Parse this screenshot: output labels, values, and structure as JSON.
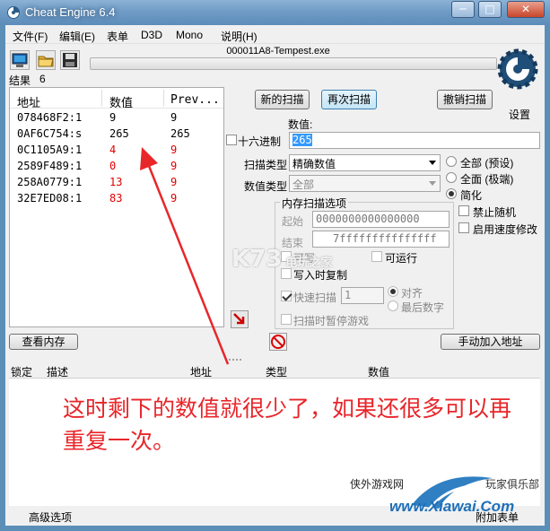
{
  "window": {
    "title": "Cheat Engine 6.4",
    "minimize": "─",
    "maximize": "□",
    "close": "✕"
  },
  "menu": [
    "文件(F)",
    "编辑(E)",
    "表单",
    "D3D",
    "Mono",
    "说明(H)"
  ],
  "toolbar": {
    "open_process_icon": "computer-icon",
    "open_file_icon": "folder-icon",
    "save_icon": "disk-icon"
  },
  "process_name": "000011A8-Tempest.exe",
  "results": {
    "label": "结果",
    "count": "6",
    "columns": [
      "地址",
      "数值",
      "Prev..."
    ],
    "rows": [
      {
        "address": "078468F2:1",
        "value": "9",
        "prev": "9",
        "changed": false
      },
      {
        "address": "0AF6C754:s",
        "value": "265",
        "prev": "265",
        "changed": false
      },
      {
        "address": "0C1105A9:1",
        "value": "4",
        "prev": "9",
        "changed": true
      },
      {
        "address": "2589F489:1",
        "value": "0",
        "prev": "9",
        "changed": true
      },
      {
        "address": "258A0779:1",
        "value": "13",
        "prev": "9",
        "changed": true
      },
      {
        "address": "32E7ED08:1",
        "value": "83",
        "prev": "9",
        "changed": true
      }
    ]
  },
  "scan": {
    "new_scan": "新的扫描",
    "next_scan": "再次扫描",
    "undo_scan": "撤销扫描",
    "settings": "设置",
    "value_label": "数值:",
    "hex_label": "十六进制",
    "value": "265",
    "scan_type_label": "扫描类型",
    "scan_type": "精确数值",
    "value_type_label": "数值类型",
    "value_type": "全部",
    "memory_options_title": "内存扫描选项",
    "start_label": "起始",
    "start_value": "0000000000000000",
    "stop_label": "结束",
    "stop_value": "7fffffffffffffff",
    "writable_label": "可写",
    "executable_label": "可运行",
    "copy_on_write_label": "写入时复制",
    "fast_scan_label": "快速扫描",
    "fast_scan_value": "1",
    "alignment_label": "对齐",
    "last_digits_label": "最后数字",
    "pause_label": "扫描时暂停游戏",
    "all_default_label": "全部 (预设)",
    "all_extreme_label": "全面 (极端)",
    "simple_label": "简化",
    "no_random_label": "禁止随机",
    "speedhack_label": "启用速度修改"
  },
  "buttons": {
    "view_memory": "查看内存",
    "add_address": "手动加入地址"
  },
  "address_list": {
    "columns": [
      "锁定",
      "描述",
      "地址",
      "类型",
      "数值"
    ]
  },
  "annotation": "这时剩下的数值就很少了，如果还很多可以再重复一次。",
  "status": {
    "advanced": "高级选项",
    "table_extras": "附加表单"
  },
  "watermarks": {
    "site_top": "侠外游戏网",
    "site_club": "玩家俱乐部",
    "site_url": "www.Xiawai.Com",
    "k73": "K73",
    "k73_sub": "电玩之家"
  },
  "colors": {
    "changed_value": "#e00000",
    "annotation": "#e8262a",
    "arrow": "#e8262a",
    "titlebar": "#6f9cc6"
  }
}
